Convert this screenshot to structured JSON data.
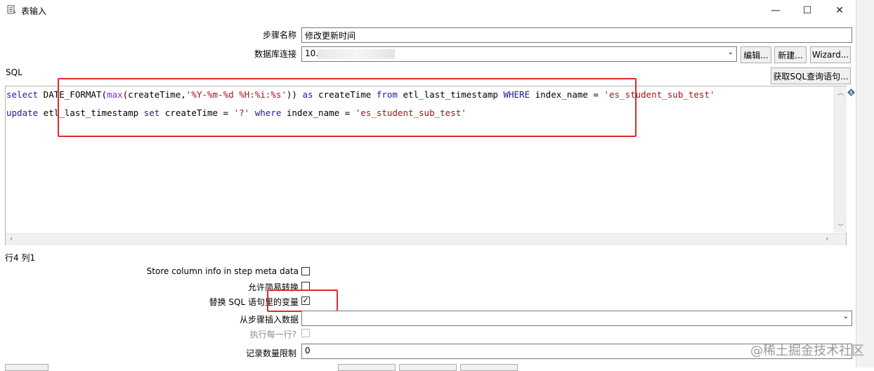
{
  "window": {
    "title": "表输入",
    "minimize": "—",
    "maximize": "☐",
    "close": "✕"
  },
  "form": {
    "step_name_label": "步骤名称",
    "step_name_value": "修改更新时间",
    "db_connection_label": "数据库连接",
    "db_connection_value": "10.",
    "edit_button": "编辑...",
    "new_button": "新建...",
    "wizard_button": "Wizard...",
    "sql_label": "SQL",
    "get_sql_button": "获取SQL查询语句..."
  },
  "sql": {
    "line1": [
      {
        "t": "select",
        "c": "kw"
      },
      {
        "t": " DATE_FORMAT(",
        "c": ""
      },
      {
        "t": "max",
        "c": "fn"
      },
      {
        "t": "(createTime,",
        "c": ""
      },
      {
        "t": "'%Y-%m-%d %H:%i:%s'",
        "c": "str"
      },
      {
        "t": ")) ",
        "c": ""
      },
      {
        "t": "as",
        "c": "kw"
      },
      {
        "t": " createTime ",
        "c": ""
      },
      {
        "t": "from",
        "c": "kw"
      },
      {
        "t": " etl_last_timestamp ",
        "c": ""
      },
      {
        "t": "WHERE",
        "c": "kw"
      },
      {
        "t": " index_name = ",
        "c": ""
      },
      {
        "t": "'es_student_sub_test'",
        "c": "str"
      }
    ],
    "line2": [
      {
        "t": "update",
        "c": "kw"
      },
      {
        "t": " etl_last_timestamp ",
        "c": ""
      },
      {
        "t": "set",
        "c": "kw"
      },
      {
        "t": " createTime = ",
        "c": ""
      },
      {
        "t": "'?'",
        "c": "str"
      },
      {
        "t": " ",
        "c": ""
      },
      {
        "t": "where",
        "c": "kw"
      },
      {
        "t": " index_name = ",
        "c": ""
      },
      {
        "t": "'es_student_sub_test'",
        "c": "str"
      }
    ]
  },
  "status": {
    "cursor_pos": "行4 列1"
  },
  "options": {
    "store_column_info_label": "Store column info in step meta data",
    "store_column_info_checked": false,
    "lazy_conversion_label": "允许简易转换",
    "lazy_conversion_checked": false,
    "replace_vars_label": "替换 SQL 语句里的变量",
    "replace_vars_checked": true,
    "insert_from_step_label": "从步骤插入数据",
    "insert_from_step_value": "",
    "execute_each_row_label": "执行每一行?",
    "execute_each_row_checked": false,
    "limit_label": "记录数量限制",
    "limit_value": "0"
  },
  "watermark": "@稀土掘金技术社区",
  "colors": {
    "keyword": "#1a1aa6",
    "function": "#8a2be2",
    "string": "#a31515",
    "highlight_box": "#e02a2a"
  }
}
